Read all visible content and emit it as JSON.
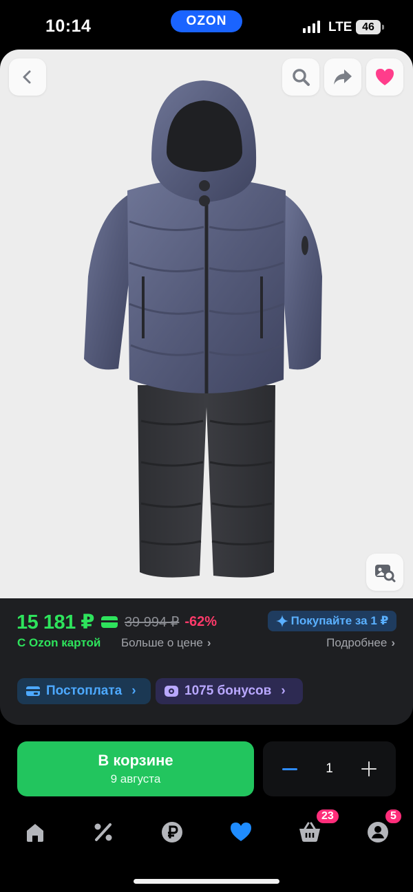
{
  "status_bar": {
    "time": "10:14",
    "network": "LTE",
    "battery": "46"
  },
  "header": {
    "brand": "OZON"
  },
  "product": {
    "image_alt": "Детский зимний комплект: куртка с капюшоном и полукомбинезон",
    "actions": [
      "back-icon",
      "search-icon",
      "share-icon",
      "heart-icon"
    ],
    "image_search_icon": "image-search-icon"
  },
  "price": {
    "current": "15 181 ₽",
    "old": "39 994 ₽",
    "discount": "-62%",
    "ozon_card_label": "С Ozon картой",
    "more_about_price": "Больше о цене",
    "promo_label": "Покупайте за 1 ₽",
    "details": "Подробнее"
  },
  "chips": {
    "postpay": "Постоплата",
    "bonus": "1075 бонусов"
  },
  "cart": {
    "button_title": "В корзине",
    "delivery_date": "9 августа",
    "quantity": "1"
  },
  "tabbar": {
    "items": [
      "home-icon",
      "percent-icon",
      "ruble-icon",
      "heart-icon",
      "cart-icon",
      "profile-icon"
    ],
    "cart_badge": "23",
    "profile_badge": "5"
  },
  "colors": {
    "accent_green": "#2ee35c",
    "ozon_blue": "#1a64ff",
    "discount_pink": "#ff3a6a",
    "favorite_pink": "#ff3d8b",
    "tab_active": "#1f8cff"
  }
}
